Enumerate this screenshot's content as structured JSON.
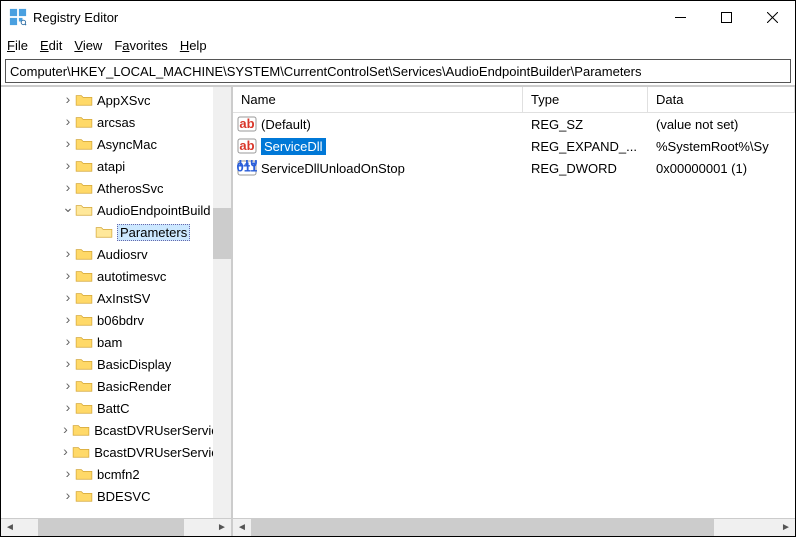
{
  "title": "Registry Editor",
  "menu": {
    "file": "File",
    "edit": "Edit",
    "view": "View",
    "favorites": "Favorites",
    "help": "Help"
  },
  "address": "Computer\\HKEY_LOCAL_MACHINE\\SYSTEM\\CurrentControlSet\\Services\\AudioEndpointBuilder\\Parameters",
  "tree": [
    {
      "label": "AppXSvc",
      "depth": 2,
      "expandable": true
    },
    {
      "label": "arcsas",
      "depth": 2,
      "expandable": true
    },
    {
      "label": "AsyncMac",
      "depth": 2,
      "expandable": true
    },
    {
      "label": "atapi",
      "depth": 2,
      "expandable": true
    },
    {
      "label": "AtherosSvc",
      "depth": 2,
      "expandable": true
    },
    {
      "label": "AudioEndpointBuild",
      "depth": 2,
      "expandable": true,
      "expanded": true
    },
    {
      "label": "Parameters",
      "depth": 3,
      "expandable": false,
      "selected": true
    },
    {
      "label": "Audiosrv",
      "depth": 2,
      "expandable": true
    },
    {
      "label": "autotimesvc",
      "depth": 2,
      "expandable": true
    },
    {
      "label": "AxInstSV",
      "depth": 2,
      "expandable": true
    },
    {
      "label": "b06bdrv",
      "depth": 2,
      "expandable": true
    },
    {
      "label": "bam",
      "depth": 2,
      "expandable": true
    },
    {
      "label": "BasicDisplay",
      "depth": 2,
      "expandable": true
    },
    {
      "label": "BasicRender",
      "depth": 2,
      "expandable": true
    },
    {
      "label": "BattC",
      "depth": 2,
      "expandable": true
    },
    {
      "label": "BcastDVRUserServic",
      "depth": 2,
      "expandable": true
    },
    {
      "label": "BcastDVRUserServic",
      "depth": 2,
      "expandable": true
    },
    {
      "label": "bcmfn2",
      "depth": 2,
      "expandable": true
    },
    {
      "label": "BDESVC",
      "depth": 2,
      "expandable": true
    }
  ],
  "columns": {
    "name": "Name",
    "type": "Type",
    "data": "Data"
  },
  "values": [
    {
      "name": "(Default)",
      "type": "REG_SZ",
      "data": "(value not set)",
      "icon": "string"
    },
    {
      "name": "ServiceDll",
      "type": "REG_EXPAND_...",
      "data": "%SystemRoot%\\Sy",
      "icon": "string",
      "selected": true
    },
    {
      "name": "ServiceDllUnloadOnStop",
      "type": "REG_DWORD",
      "data": "0x00000001 (1)",
      "icon": "binary"
    }
  ]
}
